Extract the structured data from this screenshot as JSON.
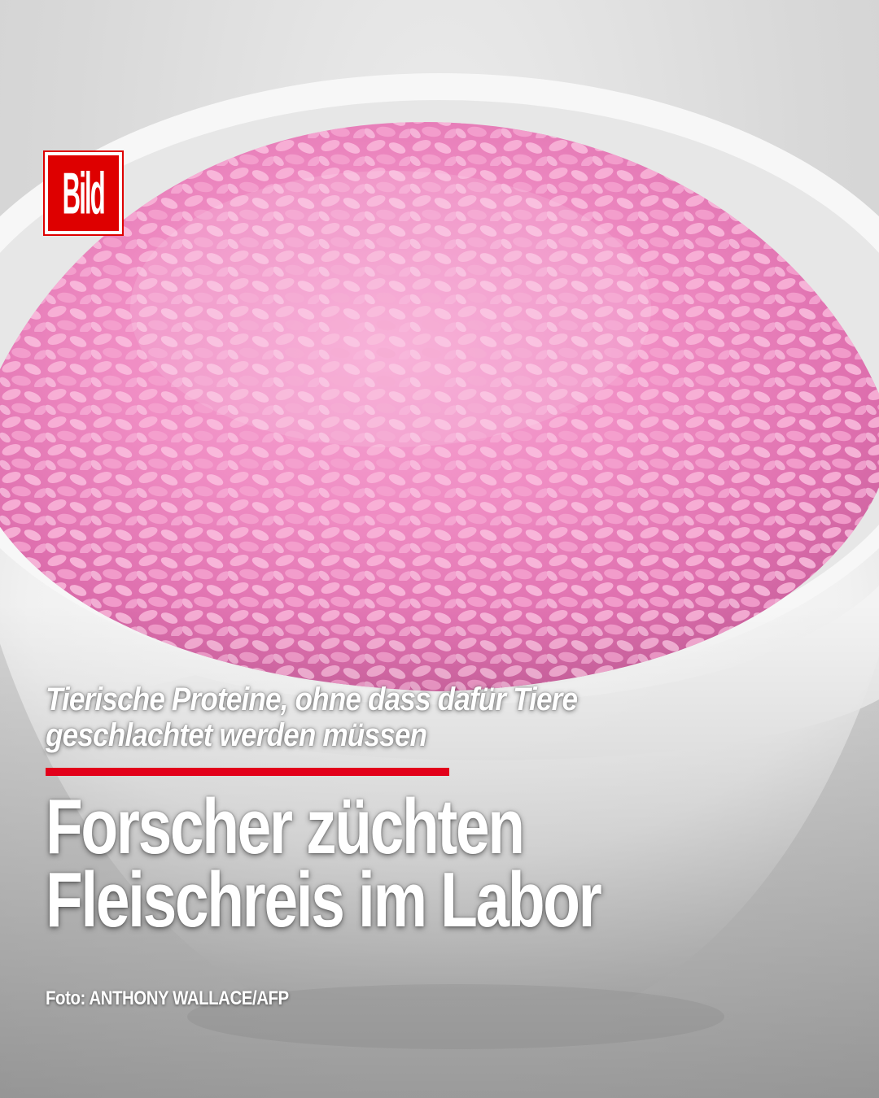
{
  "brand": {
    "logo_text": "Bild",
    "logo_color": "#de0000"
  },
  "article": {
    "kicker_line1": "Tierische Proteine, ohne dass dafür Tiere",
    "kicker_line2": "geschlachtet werden müssen",
    "headline_line1": "Forscher züchten",
    "headline_line2": "Fleischreis im Labor",
    "accent_color": "#e2001a"
  },
  "photo": {
    "credit": "Foto: ANTHONY WALLACE/AFP",
    "subject": "bowl of pink rice"
  }
}
